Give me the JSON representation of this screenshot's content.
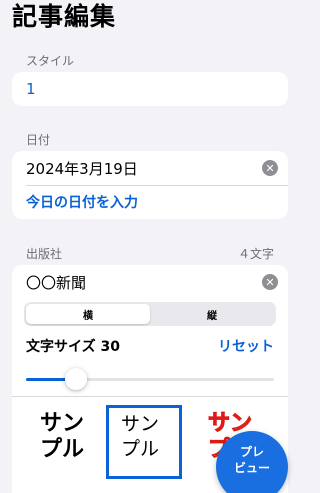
{
  "page": {
    "title": "記事編集"
  },
  "style_section": {
    "label": "スタイル",
    "value": "1"
  },
  "date_section": {
    "label": "日付",
    "value": "2024年3月19日",
    "today_link": "今日の日付を入力"
  },
  "publisher_section": {
    "label": "出版社",
    "char_count": "４文字",
    "value": "〇〇新聞",
    "orientation": {
      "options": [
        "横",
        "縦"
      ],
      "selected": "横"
    },
    "font_size_label": "文字サイズ 30",
    "reset_label": "リセット",
    "font_size": {
      "value": 30,
      "fraction": 0.2
    },
    "samples": [
      {
        "line1": "サン",
        "line2": "プル",
        "selected": false
      },
      {
        "line1": "サン",
        "line2": "プル",
        "selected": true
      },
      {
        "line1": "サン",
        "line2": "プル",
        "selected": false
      }
    ]
  },
  "fab": {
    "line1": "プレ",
    "line2": "ビュー"
  },
  "colors": {
    "accent": "#0a63d6",
    "background": "#f2f2f7",
    "card": "#ffffff",
    "secondary_text": "#6d6d72"
  },
  "icons": {
    "clear": "clear-circle-icon"
  }
}
